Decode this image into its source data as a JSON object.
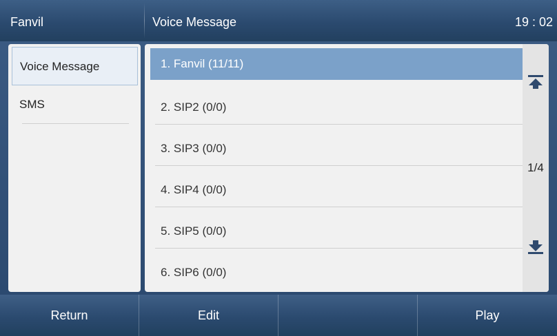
{
  "titlebar": {
    "brand": "Fanvil",
    "title": "Voice Message",
    "clock": "19 : 02"
  },
  "sidebar": {
    "items": [
      {
        "label": "Voice Message",
        "selected": true
      },
      {
        "label": "SMS",
        "selected": false
      }
    ]
  },
  "list": {
    "rows": [
      {
        "label": "1. Fanvil (11/11)",
        "selected": true
      },
      {
        "label": "2. SIP2 (0/0)",
        "selected": false
      },
      {
        "label": "3. SIP3 (0/0)",
        "selected": false
      },
      {
        "label": "4. SIP4 (0/0)",
        "selected": false
      },
      {
        "label": "5. SIP5 (0/0)",
        "selected": false
      },
      {
        "label": "6. SIP6 (0/0)",
        "selected": false
      }
    ],
    "pager": "1/4",
    "top_icon": "jump-to-top-icon",
    "bottom_icon": "jump-to-bottom-icon"
  },
  "softkeys": {
    "keys": [
      "Return",
      "Edit",
      "",
      "Play"
    ]
  },
  "colors": {
    "accent_selected": "#7ba1c9",
    "bar": "#2b4a6f"
  }
}
